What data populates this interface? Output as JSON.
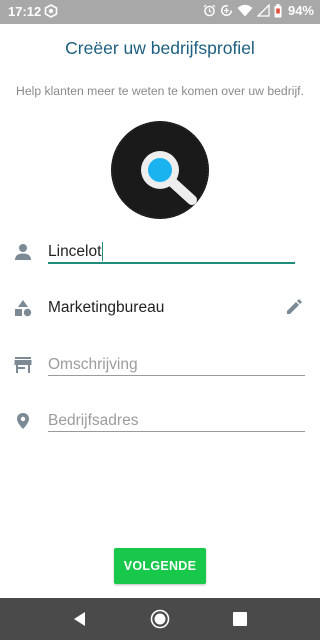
{
  "status_bar": {
    "time": "17:12",
    "battery_percent": "94%",
    "icons": [
      "app-hexagon-icon",
      "alarm-icon",
      "data-saver-icon",
      "wifi-icon",
      "signal-icon",
      "battery-icon"
    ]
  },
  "header": {
    "title": "Creëer uw bedrijfsprofiel",
    "subtitle": "Help klanten meer te weten te komen over uw bedrijf."
  },
  "logo": {
    "icon": "search-logo-icon",
    "accent": "#1ab3f0"
  },
  "form": {
    "name_value": "Lincelot",
    "category_value": "Marketingbureau",
    "description_placeholder": "Omschrijving",
    "address_placeholder": "Bedrijfsadres"
  },
  "button": {
    "next_label": "VOLGENDE",
    "color": "#17c84a"
  },
  "colors": {
    "title": "#1d5f80",
    "field_accent": "#1e8c7a",
    "icons": "#7b8a95"
  }
}
